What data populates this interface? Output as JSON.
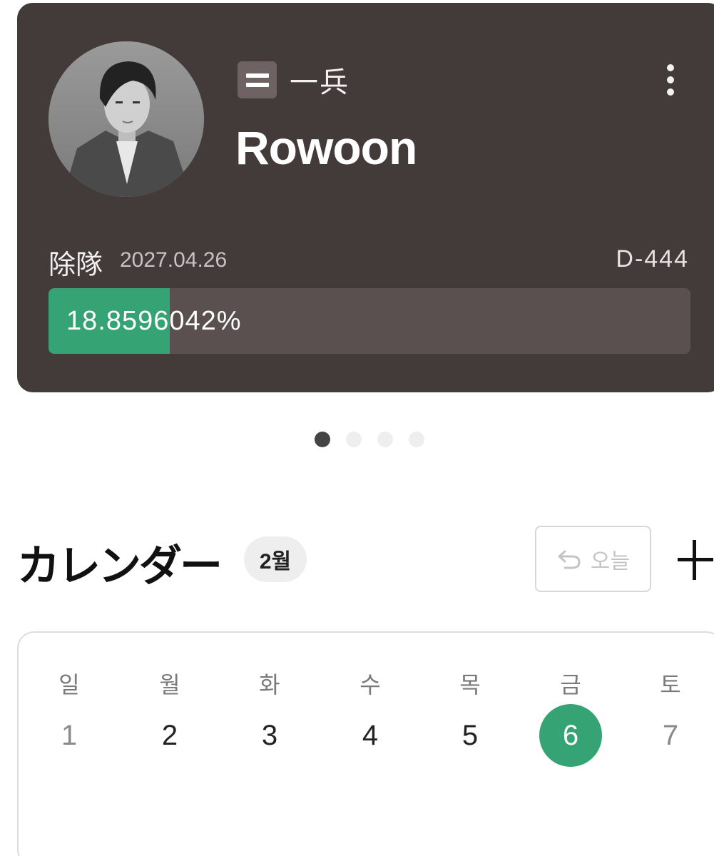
{
  "profile": {
    "rank_icon": "two-bar-rank-insignia",
    "rank": "一兵",
    "name": "Rowoon",
    "discharge_label": "除隊",
    "discharge_date": "2027.04.26",
    "dday": "D-444",
    "progress_text": "18.8596042%",
    "progress_fraction": 0.188596042,
    "more_icon": "vertical-ellipsis-icon"
  },
  "pager": {
    "total": 4,
    "active_index": 0
  },
  "calendar": {
    "title": "カレンダー",
    "month_badge": "2월",
    "today_button": {
      "icon": "undo-arrow-icon",
      "label": "오늘"
    },
    "add_icon": "plus-icon",
    "weekdays": [
      "일",
      "월",
      "화",
      "수",
      "목",
      "금",
      "토"
    ],
    "days": [
      "1",
      "2",
      "3",
      "4",
      "5",
      "6",
      "7"
    ],
    "selected_day": "6"
  },
  "colors": {
    "card_bg": "#433a3a",
    "progress_track": "#5a5050",
    "accent_green": "#35a373",
    "badge_bg": "#6e6262"
  }
}
